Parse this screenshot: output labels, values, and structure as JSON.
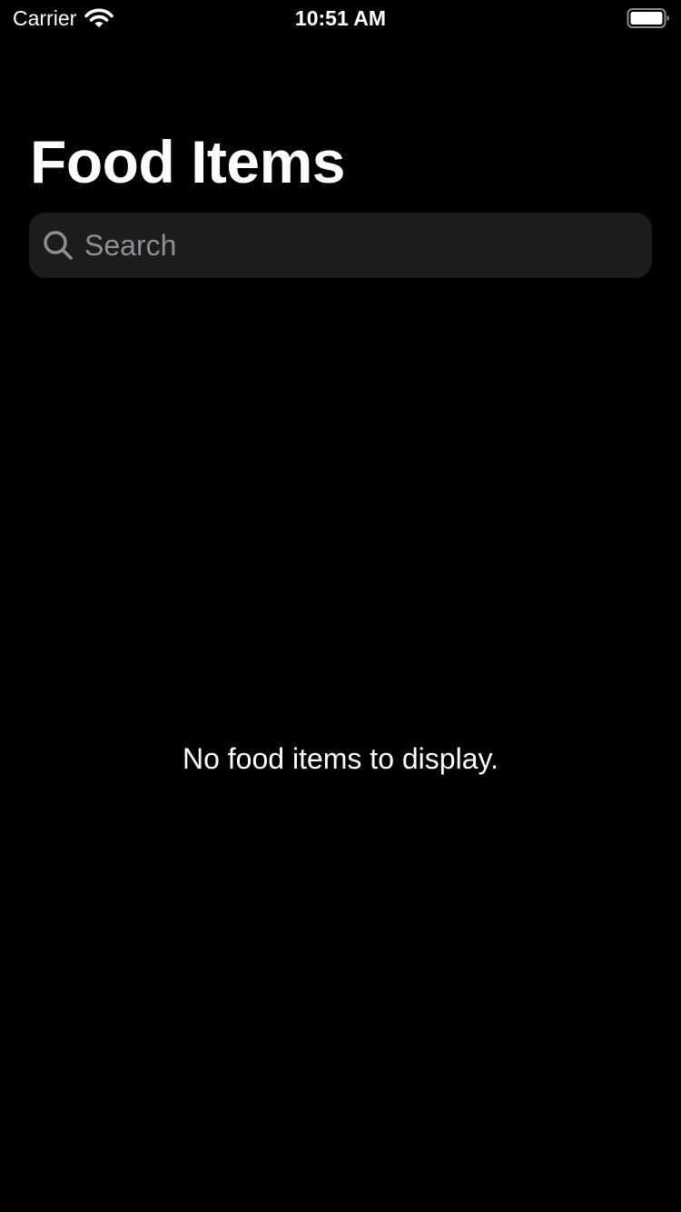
{
  "status_bar": {
    "carrier": "Carrier",
    "time": "10:51 AM",
    "wifi_icon": "wifi-icon",
    "battery_icon": "battery-icon"
  },
  "header": {
    "title": "Food Items"
  },
  "search": {
    "placeholder": "Search",
    "value": "",
    "icon": "search-icon"
  },
  "main": {
    "empty_message": "No food items to display."
  },
  "colors": {
    "background": "#000000",
    "text": "#ffffff",
    "search_field": "#1c1c1e",
    "placeholder": "#8e8e93"
  }
}
